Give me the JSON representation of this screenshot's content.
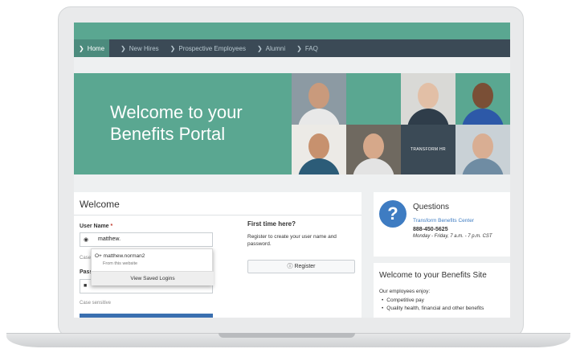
{
  "nav": {
    "items": [
      {
        "label": "Home",
        "active": true,
        "icon": "circle-arrow-icon"
      },
      {
        "label": "New Hires",
        "active": false,
        "icon": "chevron-right-icon"
      },
      {
        "label": "Prospective Employees",
        "active": false,
        "icon": "chevron-right-icon"
      },
      {
        "label": "Alumni",
        "active": false,
        "icon": "chevron-right-icon"
      },
      {
        "label": "FAQ",
        "active": false,
        "icon": "circle-arrow-icon"
      }
    ]
  },
  "hero": {
    "title": "Welcome to your Benefits Portal",
    "brand_tag": "TRANSFORM HR"
  },
  "login": {
    "title": "Welcome",
    "username_label": "User Name",
    "required_mark": "*",
    "username_value": "matthew.",
    "username_hint": "Case",
    "password_label": "Pass",
    "password_hint": "Case sensitive"
  },
  "autofill": {
    "user": "O+ matthew.norman2",
    "source": "From this website",
    "button": "View Saved Logins"
  },
  "first_time": {
    "title": "First time here?",
    "text": "Register to create your user name and password.",
    "register_label": "Register"
  },
  "questions": {
    "title": "Questions",
    "center": "Transform Benefits Center",
    "phone": "888-450-5625",
    "hours": "Monday - Friday, 7 a.m. - 7 p.m. CST"
  },
  "site": {
    "title": "Welcome to your Benefits Site",
    "intro": "Our employees enjoy:",
    "benefits": [
      "Competitive pay",
      "Quality health, financial and other benefits"
    ]
  },
  "colors": {
    "teal": "#5aa791",
    "nav": "#3b4a56",
    "link_blue": "#3e7cc2"
  }
}
